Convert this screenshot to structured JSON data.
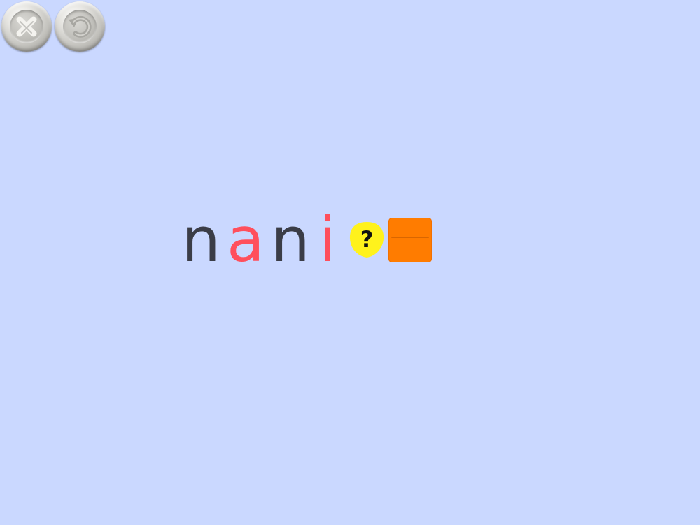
{
  "toolbar": {
    "close_icon": "close-icon",
    "undo_icon": "undo-icon"
  },
  "puzzle": {
    "letters": [
      {
        "char": "n",
        "color": "#3b3d47"
      },
      {
        "char": "a",
        "color": "#ff4f5c"
      },
      {
        "char": "n",
        "color": "#3b3d47"
      },
      {
        "char": "i",
        "color": "#ff4f5c"
      }
    ],
    "hint_symbol": "?",
    "hint_color": "#fff21c",
    "slot_color": "#ff7c00"
  },
  "colors": {
    "background": "#cad8ff"
  }
}
